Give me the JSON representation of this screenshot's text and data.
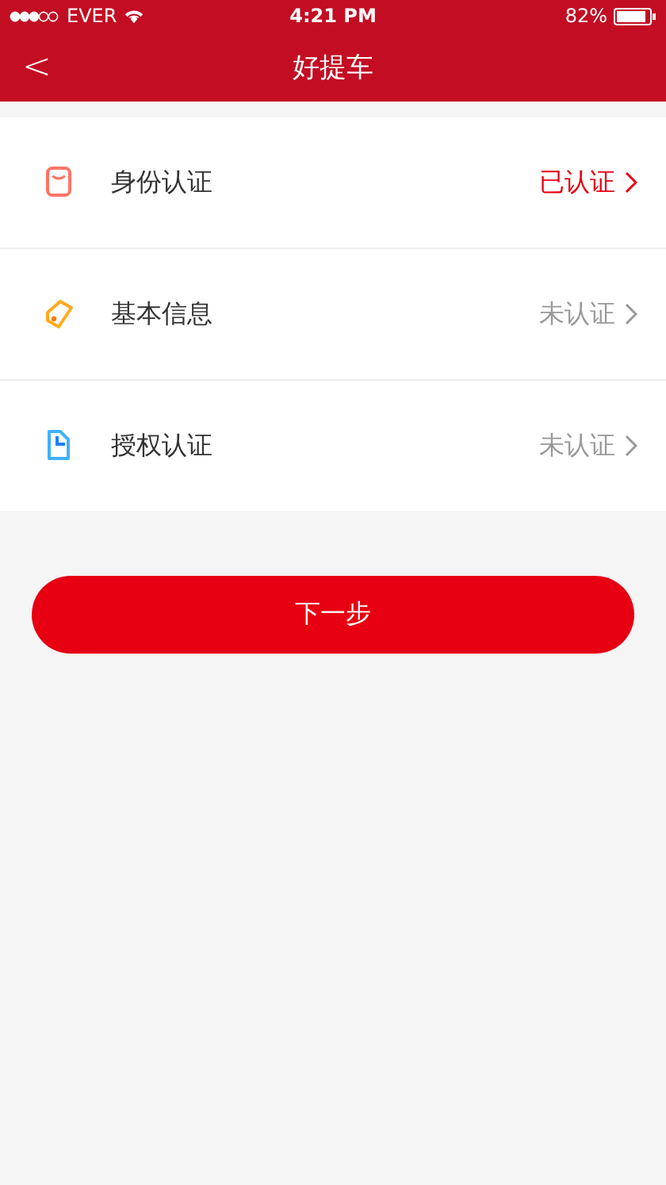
{
  "status_bar": {
    "carrier": "EVER",
    "time": "4:21 PM",
    "battery": "82%"
  },
  "nav": {
    "back": "<",
    "title": "好提车"
  },
  "items": [
    {
      "kind": "id",
      "label": "身份认证",
      "status": "已认证",
      "verified": true
    },
    {
      "kind": "tag",
      "label": "基本信息",
      "status": "未认证",
      "verified": false
    },
    {
      "kind": "doc",
      "label": "授权认证",
      "status": "未认证",
      "verified": false
    }
  ],
  "button": "下一步"
}
